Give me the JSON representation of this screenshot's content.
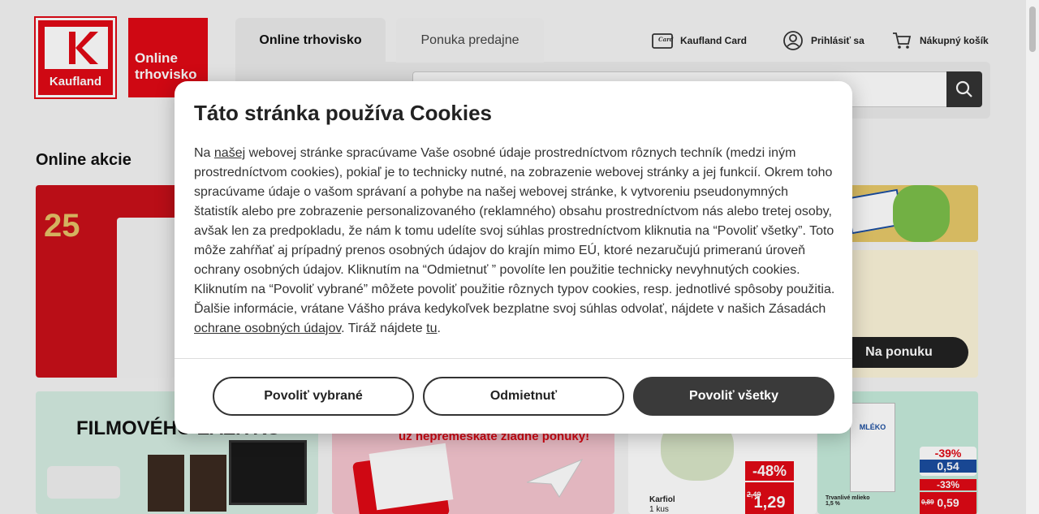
{
  "header": {
    "logo_text": "Kaufland",
    "market_logo_line1": "Online",
    "market_logo_line2": "trhovisko",
    "tabs": [
      {
        "label": "Online trhovisko"
      },
      {
        "label": "Ponuka predajne"
      }
    ],
    "links": {
      "card": "Kaufland Card",
      "login": "Prihlásiť sa",
      "cart": "Nákupný košík"
    }
  },
  "main": {
    "section_title": "Online akcie",
    "promo_number": "25",
    "offer_button": "Na ponuku",
    "film_headline": "FILMOVÉHO ZÁŽITKU",
    "pink_headline": "už nepremeškáte žiadne ponuky!",
    "product1": {
      "name": "Karfiol",
      "qty": "1 kus",
      "discount": "-48%",
      "old_price": "2,49",
      "price": "1,29"
    },
    "product2": {
      "brand": "MLÉKO",
      "discount1": "-39%",
      "price1": "0,54",
      "discount2": "-33%",
      "old_price": "0,89",
      "price2": "0,59",
      "name": "Trvanlivé mlieko 1,5 %"
    }
  },
  "cookie_modal": {
    "title": "Táto stránka používa Cookies",
    "body_before_link1": "Na ",
    "link1": "našej",
    "body_main": " webovej stránke spracúvame Vaše osobné údaje prostredníctvom rôznych techník (medzi iným prostredníctvom cookies), pokiaľ je to technicky nutné, na zobrazenie webovej stránky a jej funkcií. Okrem toho spracúvame údaje o vašom správaní a pohybe na našej webovej stránke, k vytvoreniu pseudonymných štatistík alebo pre zobrazenie personalizovaného (reklamného) obsahu prostredníctvom nás alebo tretej osoby, avšak len za predpokladu, že nám k tomu udelíte svoj súhlas prostredníctvom kliknutia na “Povoliť všetky”. Toto môže zahŕňať aj prípadný prenos osobných údajov do krajín mimo EÚ, ktoré nezaručujú primeranú úroveň ochrany osobných údajov. Kliknutím na “Odmietnuť ” povolíte len použitie technicky nevyhnutých cookies. Kliknutím na “Povoliť vybrané” môžete povoliť použitie rôznych typov cookies, resp. jednotlivé spôsoby použitia. Ďalšie informácie, vrátane Vášho práva kedykoľvek bezplatne svoj súhlas odvolať, nájdete v našich Zásadách ",
    "link2": "ochrane osobných údajov",
    "body_after_link2": ". Tiráž nájdete ",
    "link3": "tu",
    "body_end": ".",
    "buttons": {
      "select": "Povoliť vybrané",
      "reject": "Odmietnuť",
      "accept_all": "Povoliť všetky"
    }
  },
  "colors": {
    "brand_red": "#e10915",
    "dark": "#3a3a3a"
  }
}
